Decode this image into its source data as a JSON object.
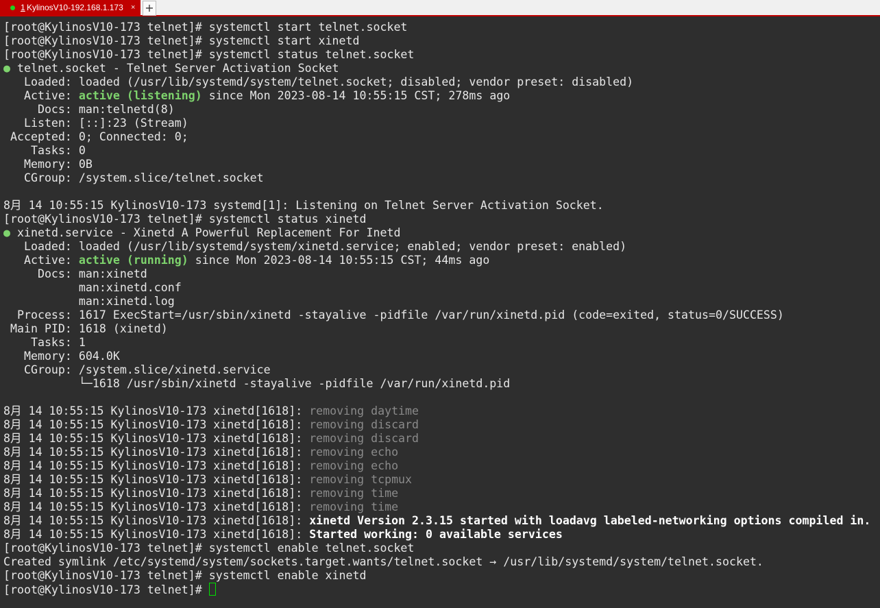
{
  "tab": {
    "number": "1",
    "title": "KylinosV10-192.168.1.173",
    "close": "×",
    "new_tab": "+"
  },
  "colors": {
    "accent": "#c00000",
    "active_green": "#7ed36d",
    "dim": "#8a8a8a"
  },
  "lines": [
    [
      [
        "[root@KylinosV10-173 telnet]# systemctl start telnet.socket",
        ""
      ]
    ],
    [
      [
        "[root@KylinosV10-173 telnet]# systemctl start xinetd",
        ""
      ]
    ],
    [
      [
        "[root@KylinosV10-173 telnet]# systemctl status telnet.socket",
        ""
      ]
    ],
    [
      [
        "●",
        "dotg"
      ],
      [
        " telnet.socket - Telnet Server Activation Socket",
        ""
      ]
    ],
    [
      [
        "   Loaded: loaded (/usr/lib/systemd/system/telnet.socket; disabled; vendor preset: disabled)",
        ""
      ]
    ],
    [
      [
        "   Active: ",
        ""
      ],
      [
        "active (listening)",
        "g"
      ],
      [
        " since Mon 2023-08-14 10:55:15 CST; 278ms ago",
        ""
      ]
    ],
    [
      [
        "     Docs: man:telnetd(8)",
        ""
      ]
    ],
    [
      [
        "   Listen: [::]:23 (Stream)",
        ""
      ]
    ],
    [
      [
        " Accepted: 0; Connected: 0;",
        ""
      ]
    ],
    [
      [
        "    Tasks: 0",
        ""
      ]
    ],
    [
      [
        "   Memory: 0B",
        ""
      ]
    ],
    [
      [
        "   CGroup: /system.slice/telnet.socket",
        ""
      ]
    ],
    [
      [
        "",
        ""
      ]
    ],
    [
      [
        "8月 14 10:55:15 KylinosV10-173 systemd[1]: Listening on Telnet Server Activation Socket.",
        ""
      ]
    ],
    [
      [
        "[root@KylinosV10-173 telnet]# systemctl status xinetd",
        ""
      ]
    ],
    [
      [
        "●",
        "dotg"
      ],
      [
        " xinetd.service - Xinetd A Powerful Replacement For Inetd",
        ""
      ]
    ],
    [
      [
        "   Loaded: loaded (/usr/lib/systemd/system/xinetd.service; enabled; vendor preset: enabled)",
        ""
      ]
    ],
    [
      [
        "   Active: ",
        ""
      ],
      [
        "active (running)",
        "g"
      ],
      [
        " since Mon 2023-08-14 10:55:15 CST; 44ms ago",
        ""
      ]
    ],
    [
      [
        "     Docs: man:xinetd",
        ""
      ]
    ],
    [
      [
        "           man:xinetd.conf",
        ""
      ]
    ],
    [
      [
        "           man:xinetd.log",
        ""
      ]
    ],
    [
      [
        "  Process: 1617 ExecStart=/usr/sbin/xinetd -stayalive -pidfile /var/run/xinetd.pid (code=exited, status=0/SUCCESS)",
        ""
      ]
    ],
    [
      [
        " Main PID: 1618 (xinetd)",
        ""
      ]
    ],
    [
      [
        "    Tasks: 1",
        ""
      ]
    ],
    [
      [
        "   Memory: 604.0K",
        ""
      ]
    ],
    [
      [
        "   CGroup: /system.slice/xinetd.service",
        ""
      ]
    ],
    [
      [
        "           └─1618 /usr/sbin/xinetd -stayalive -pidfile /var/run/xinetd.pid",
        ""
      ]
    ],
    [
      [
        "",
        ""
      ]
    ],
    [
      [
        "8月 14 10:55:15 KylinosV10-173 xinetd[1618]: ",
        ""
      ],
      [
        "removing daytime",
        "dim"
      ]
    ],
    [
      [
        "8月 14 10:55:15 KylinosV10-173 xinetd[1618]: ",
        ""
      ],
      [
        "removing discard",
        "dim"
      ]
    ],
    [
      [
        "8月 14 10:55:15 KylinosV10-173 xinetd[1618]: ",
        ""
      ],
      [
        "removing discard",
        "dim"
      ]
    ],
    [
      [
        "8月 14 10:55:15 KylinosV10-173 xinetd[1618]: ",
        ""
      ],
      [
        "removing echo",
        "dim"
      ]
    ],
    [
      [
        "8月 14 10:55:15 KylinosV10-173 xinetd[1618]: ",
        ""
      ],
      [
        "removing echo",
        "dim"
      ]
    ],
    [
      [
        "8月 14 10:55:15 KylinosV10-173 xinetd[1618]: ",
        ""
      ],
      [
        "removing tcpmux",
        "dim"
      ]
    ],
    [
      [
        "8月 14 10:55:15 KylinosV10-173 xinetd[1618]: ",
        ""
      ],
      [
        "removing time",
        "dim"
      ]
    ],
    [
      [
        "8月 14 10:55:15 KylinosV10-173 xinetd[1618]: ",
        ""
      ],
      [
        "removing time",
        "dim"
      ]
    ],
    [
      [
        "8月 14 10:55:15 KylinosV10-173 xinetd[1618]: ",
        ""
      ],
      [
        "xinetd Version 2.3.15 started with loadavg labeled-networking options compiled in.",
        "b"
      ]
    ],
    [
      [
        "8月 14 10:55:15 KylinosV10-173 xinetd[1618]: ",
        ""
      ],
      [
        "Started working: 0 available services",
        "b"
      ]
    ],
    [
      [
        "[root@KylinosV10-173 telnet]# systemctl enable telnet.socket",
        ""
      ]
    ],
    [
      [
        "Created symlink /etc/systemd/system/sockets.target.wants/telnet.socket → /usr/lib/systemd/system/telnet.socket.",
        ""
      ]
    ],
    [
      [
        "[root@KylinosV10-173 telnet]# systemctl enable xinetd",
        ""
      ]
    ],
    [
      [
        "[root@KylinosV10-173 telnet]# ",
        ""
      ]
    ]
  ]
}
